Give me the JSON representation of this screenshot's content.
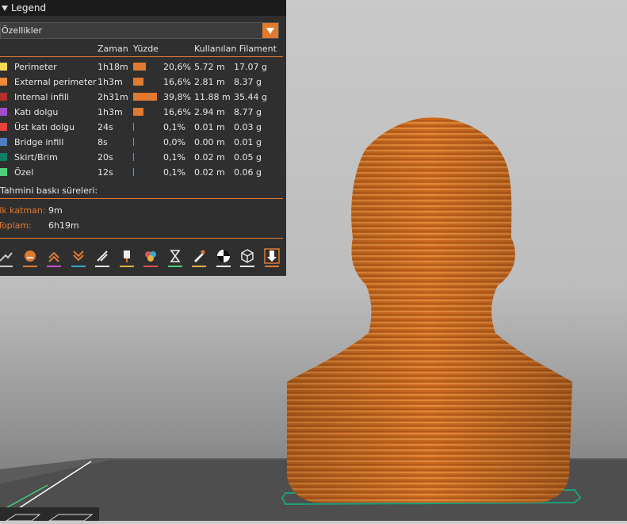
{
  "legend": {
    "title": "Legend",
    "feature_select": "Özellikler",
    "columns": {
      "time": "Zaman",
      "percent": "Yüzde",
      "filament": "Kullanılan Filament"
    },
    "rows": [
      {
        "name": "Perimeter",
        "time": "1h18m",
        "percent": "20,6%",
        "length": "5.72 m",
        "weight": "17.07 g",
        "fraction": 0.206,
        "color": "#f6dc53"
      },
      {
        "name": "External perimeter",
        "time": "1h3m",
        "percent": "16,6%",
        "length": "2.81 m",
        "weight": "8.37 g",
        "fraction": 0.166,
        "color": "#ef8a3b"
      },
      {
        "name": "Internal infill",
        "time": "2h31m",
        "percent": "39,8%",
        "length": "11.88 m",
        "weight": "35.44 g",
        "fraction": 0.398,
        "color": "#b0322b"
      },
      {
        "name": "Katı dolgu",
        "time": "1h3m",
        "percent": "16,6%",
        "length": "2.94 m",
        "weight": "8.77 g",
        "fraction": 0.166,
        "color": "#9e4ec8"
      },
      {
        "name": "Üst katı dolgu",
        "time": "24s",
        "percent": "0,1%",
        "length": "0.01 m",
        "weight": "0.03 g",
        "fraction": 0.001,
        "color": "#e8423c"
      },
      {
        "name": "Bridge infill",
        "time": "8s",
        "percent": "0,0%",
        "length": "0.00 m",
        "weight": "0.01 g",
        "fraction": 0.0,
        "color": "#4f7fbf"
      },
      {
        "name": "Skirt/Brim",
        "time": "20s",
        "percent": "0,1%",
        "length": "0.02 m",
        "weight": "0.05 g",
        "fraction": 0.001,
        "color": "#0d7c64"
      },
      {
        "name": "Özel",
        "time": "12s",
        "percent": "0,1%",
        "length": "0.02 m",
        "weight": "0.06 g",
        "fraction": 0.001,
        "color": "#4fcf7e"
      }
    ],
    "estimate_label": "Tahmini baskı süreleri:",
    "first_layer_label": "İlk katman:",
    "first_layer_value": "9m",
    "total_label": "Toplam:",
    "total_value": "6h19m"
  },
  "toolbar": {
    "icons": [
      {
        "name": "travel-icon",
        "accent": "#cccccc"
      },
      {
        "name": "wipe-icon",
        "accent": "#e07a2f"
      },
      {
        "name": "retractions-icon",
        "accent": "#c34fd0"
      },
      {
        "name": "deretractions-icon",
        "accent": "#3aa7c9"
      },
      {
        "name": "seams-icon",
        "accent": "#e6e6e6"
      },
      {
        "name": "tool-changes-icon",
        "accent": "#e0b040"
      },
      {
        "name": "color-changes-icon",
        "accent": "#e05050"
      },
      {
        "name": "pause-prints-icon",
        "accent": "#4fcf7e"
      },
      {
        "name": "custom-gcodes-icon",
        "accent": "#e0b040"
      },
      {
        "name": "center-of-gravity-icon",
        "accent": "#ffffff"
      },
      {
        "name": "shells-icon",
        "accent": "#e6e6e6"
      },
      {
        "name": "tool-marker-icon",
        "accent": "#e07a2f"
      }
    ]
  },
  "colors": {
    "accent": "#e07a2f",
    "model": "#d2691e",
    "panel": "#2f2f2f"
  }
}
